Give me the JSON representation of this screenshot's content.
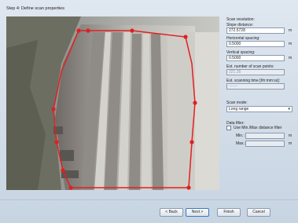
{
  "step_title": "Step 4: Define scan properties",
  "scan_resolution": {
    "heading": "Scan resolution:",
    "slope_distance_label": "Slope distance:",
    "slope_distance_value": "272.5728",
    "slope_distance_unit": "m",
    "horizontal_spacing_label": "Horizontal spacing:",
    "horizontal_spacing_value": "0.5000",
    "horizontal_spacing_unit": "m",
    "vertical_spacing_label": "Vertical spacing:",
    "vertical_spacing_value": "0.5000",
    "vertical_spacing_unit": "m",
    "est_points_label": "Est. number of scan points:",
    "est_points_value": "321.35",
    "est_time_label": "Est. scanning time [hh:mm:ss]:",
    "est_time_value": "-:--:--"
  },
  "scan_mode": {
    "heading": "Scan mode:",
    "selected": "Long range"
  },
  "data_filter": {
    "heading": "Data filter:",
    "checkbox_label": "Use Min./Max distance filter",
    "checked": false,
    "min_label": "Min.:",
    "min_unit": "m",
    "max_label": "Max.:",
    "max_unit": "m"
  },
  "buttons": {
    "back": "< Back",
    "next": "Next >",
    "finish": "Finish",
    "cancel": "Cancel"
  },
  "colors": {
    "polygon": "#e02020",
    "window_bg": "#c9d6e3"
  }
}
